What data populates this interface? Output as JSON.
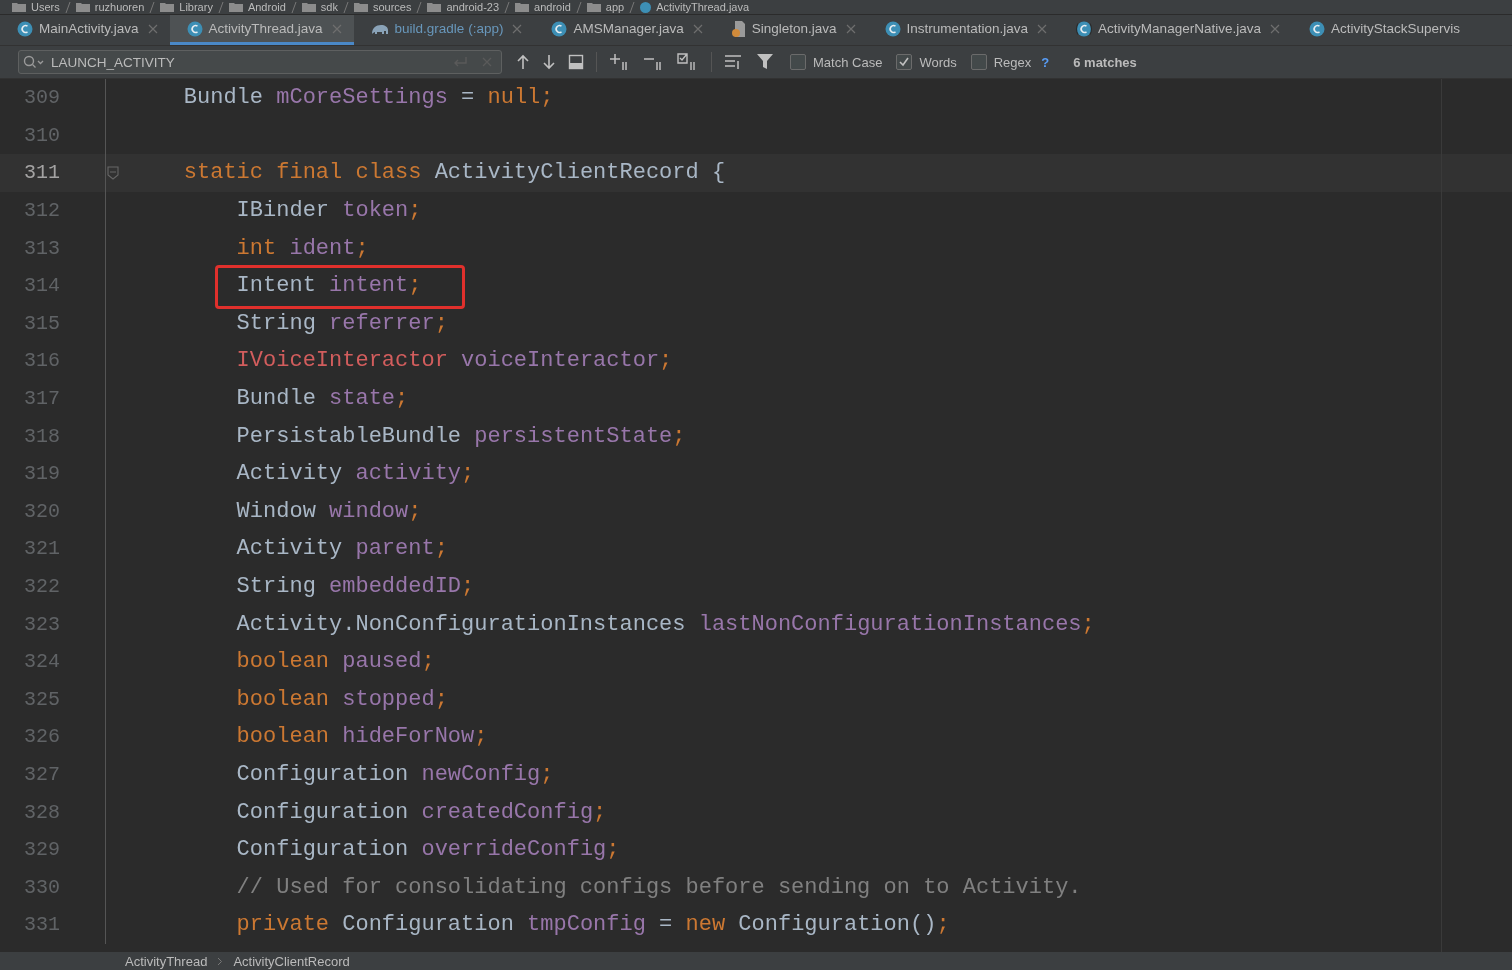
{
  "breadcrumb": [
    "Users",
    "ruzhuoren",
    "Library",
    "Android",
    "sdk",
    "sources",
    "android-23",
    "android",
    "app",
    "ActivityThread.java"
  ],
  "tabs": [
    {
      "label": "MainActivity.java",
      "kind": "class",
      "selected": false,
      "changed": false
    },
    {
      "label": "ActivityThread.java",
      "kind": "class",
      "selected": true,
      "changed": false
    },
    {
      "label": "build.gradle (:app)",
      "kind": "gradle",
      "selected": false,
      "changed": true
    },
    {
      "label": "AMSManager.java",
      "kind": "class",
      "selected": false,
      "changed": false
    },
    {
      "label": "Singleton.java",
      "kind": "file",
      "selected": false,
      "changed": false
    },
    {
      "label": "Instrumentation.java",
      "kind": "class",
      "selected": false,
      "changed": false
    },
    {
      "label": "ActivityManagerNative.java",
      "kind": "abstract",
      "selected": false,
      "changed": false
    },
    {
      "label": "ActivityStackSupervis",
      "kind": "class",
      "selected": false,
      "changed": false
    }
  ],
  "search": {
    "value": "LAUNCH_ACTIVITY"
  },
  "options": [
    {
      "label": "Match Case",
      "checked": false
    },
    {
      "label": "Words",
      "checked": true
    },
    {
      "label": "Regex",
      "checked": false
    }
  ],
  "help": "?",
  "match_count": "6 matches",
  "code": [
    {
      "number": "309",
      "current": false,
      "boxed": false,
      "tokens": [
        {
          "kind": "plain",
          "text": "    Bundle "
        },
        {
          "kind": "field",
          "text": "mCoreSettings"
        },
        {
          "kind": "plain",
          "text": " = "
        },
        {
          "kind": "keyword",
          "text": "null;"
        }
      ]
    },
    {
      "number": "310",
      "current": false,
      "boxed": false
    },
    {
      "number": "311",
      "current": true,
      "boxed": false,
      "tokens": [
        {
          "kind": "keyword",
          "text": "    static final class "
        },
        {
          "kind": "plain",
          "text": "ActivityClientRecord {"
        }
      ]
    },
    {
      "number": "312",
      "current": false,
      "boxed": false,
      "tokens": [
        {
          "kind": "plain",
          "text": "        IBinder "
        },
        {
          "kind": "field",
          "text": "token"
        },
        {
          "kind": "keyword",
          "text": ";"
        }
      ]
    },
    {
      "number": "313",
      "current": false,
      "boxed": false,
      "tokens": [
        {
          "kind": "keyword",
          "text": "        int "
        },
        {
          "kind": "field",
          "text": "ident"
        },
        {
          "kind": "keyword",
          "text": ";"
        }
      ]
    },
    {
      "number": "314",
      "current": false,
      "boxed": true,
      "tokens": [
        {
          "kind": "plain",
          "text": "        Intent "
        },
        {
          "kind": "field",
          "text": "intent"
        },
        {
          "kind": "keyword",
          "text": ";"
        }
      ]
    },
    {
      "number": "315",
      "current": false,
      "boxed": false,
      "tokens": [
        {
          "kind": "plain",
          "text": "        String "
        },
        {
          "kind": "field",
          "text": "referrer"
        },
        {
          "kind": "keyword",
          "text": ";"
        }
      ]
    },
    {
      "number": "316",
      "current": false,
      "boxed": false,
      "tokens": [
        {
          "kind": "error",
          "text": "        IVoiceInteractor "
        },
        {
          "kind": "field",
          "text": "voiceInteractor"
        },
        {
          "kind": "keyword",
          "text": ";"
        }
      ]
    },
    {
      "number": "317",
      "current": false,
      "boxed": false,
      "tokens": [
        {
          "kind": "plain",
          "text": "        Bundle "
        },
        {
          "kind": "field",
          "text": "state"
        },
        {
          "kind": "keyword",
          "text": ";"
        }
      ]
    },
    {
      "number": "318",
      "current": false,
      "boxed": false,
      "tokens": [
        {
          "kind": "plain",
          "text": "        PersistableBundle "
        },
        {
          "kind": "field",
          "text": "persistentState"
        },
        {
          "kind": "keyword",
          "text": ";"
        }
      ]
    },
    {
      "number": "319",
      "current": false,
      "boxed": false,
      "tokens": [
        {
          "kind": "plain",
          "text": "        Activity "
        },
        {
          "kind": "field",
          "text": "activity"
        },
        {
          "kind": "keyword",
          "text": ";"
        }
      ]
    },
    {
      "number": "320",
      "current": false,
      "boxed": false,
      "tokens": [
        {
          "kind": "plain",
          "text": "        Window "
        },
        {
          "kind": "field",
          "text": "window"
        },
        {
          "kind": "keyword",
          "text": ";"
        }
      ]
    },
    {
      "number": "321",
      "current": false,
      "boxed": false,
      "tokens": [
        {
          "kind": "plain",
          "text": "        Activity "
        },
        {
          "kind": "field",
          "text": "parent"
        },
        {
          "kind": "keyword",
          "text": ";"
        }
      ]
    },
    {
      "number": "322",
      "current": false,
      "boxed": false,
      "tokens": [
        {
          "kind": "plain",
          "text": "        String "
        },
        {
          "kind": "field",
          "text": "embeddedID"
        },
        {
          "kind": "keyword",
          "text": ";"
        }
      ]
    },
    {
      "number": "323",
      "current": false,
      "boxed": false,
      "tokens": [
        {
          "kind": "plain",
          "text": "        Activity.NonConfigurationInstances "
        },
        {
          "kind": "field",
          "text": "lastNonConfigurationInstances"
        },
        {
          "kind": "keyword",
          "text": ";"
        }
      ]
    },
    {
      "number": "324",
      "current": false,
      "boxed": false,
      "tokens": [
        {
          "kind": "keyword",
          "text": "        boolean "
        },
        {
          "kind": "field",
          "text": "paused"
        },
        {
          "kind": "keyword",
          "text": ";"
        }
      ]
    },
    {
      "number": "325",
      "current": false,
      "boxed": false,
      "tokens": [
        {
          "kind": "keyword",
          "text": "        boolean "
        },
        {
          "kind": "field",
          "text": "stopped"
        },
        {
          "kind": "keyword",
          "text": ";"
        }
      ]
    },
    {
      "number": "326",
      "current": false,
      "boxed": false,
      "tokens": [
        {
          "kind": "keyword",
          "text": "        boolean "
        },
        {
          "kind": "field",
          "text": "hideForNow"
        },
        {
          "kind": "keyword",
          "text": ";"
        }
      ]
    },
    {
      "number": "327",
      "current": false,
      "boxed": false,
      "tokens": [
        {
          "kind": "plain",
          "text": "        Configuration "
        },
        {
          "kind": "field",
          "text": "newConfig"
        },
        {
          "kind": "keyword",
          "text": ";"
        }
      ]
    },
    {
      "number": "328",
      "current": false,
      "boxed": false,
      "tokens": [
        {
          "kind": "plain",
          "text": "        Configuration "
        },
        {
          "kind": "field",
          "text": "createdConfig"
        },
        {
          "kind": "keyword",
          "text": ";"
        }
      ]
    },
    {
      "number": "329",
      "current": false,
      "boxed": false,
      "tokens": [
        {
          "kind": "plain",
          "text": "        Configuration "
        },
        {
          "kind": "field",
          "text": "overrideConfig"
        },
        {
          "kind": "keyword",
          "text": ";"
        }
      ]
    },
    {
      "number": "330",
      "current": false,
      "boxed": false,
      "tokens": [
        {
          "kind": "comment",
          "text": "        // Used for consolidating configs before sending on to Activity."
        }
      ]
    },
    {
      "number": "331",
      "current": false,
      "boxed": false,
      "tokens": [
        {
          "kind": "keyword",
          "text": "        private "
        },
        {
          "kind": "plain",
          "text": "Configuration "
        },
        {
          "kind": "field",
          "text": "tmpConfig"
        },
        {
          "kind": "plain",
          "text": " = "
        },
        {
          "kind": "keyword",
          "text": "new "
        },
        {
          "kind": "plain",
          "text": "Configuration()"
        },
        {
          "kind": "keyword",
          "text": ";"
        }
      ]
    }
  ],
  "status_breadcrumb": [
    "ActivityThread",
    "ActivityClientRecord"
  ]
}
